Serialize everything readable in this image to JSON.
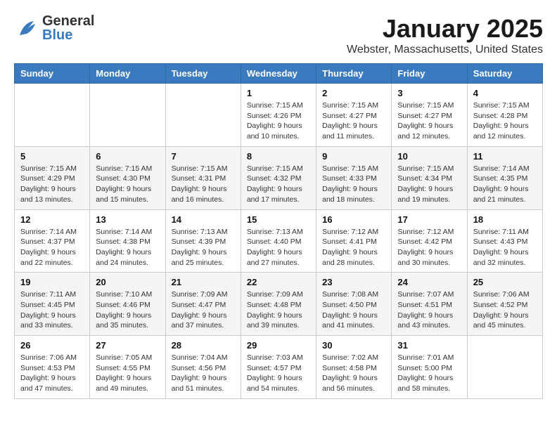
{
  "header": {
    "logo_general": "General",
    "logo_blue": "Blue",
    "title": "January 2025",
    "location": "Webster, Massachusetts, United States"
  },
  "weekdays": [
    "Sunday",
    "Monday",
    "Tuesday",
    "Wednesday",
    "Thursday",
    "Friday",
    "Saturday"
  ],
  "weeks": [
    [
      {
        "day": "",
        "info": ""
      },
      {
        "day": "",
        "info": ""
      },
      {
        "day": "",
        "info": ""
      },
      {
        "day": "1",
        "info": "Sunrise: 7:15 AM\nSunset: 4:26 PM\nDaylight: 9 hours\nand 10 minutes."
      },
      {
        "day": "2",
        "info": "Sunrise: 7:15 AM\nSunset: 4:27 PM\nDaylight: 9 hours\nand 11 minutes."
      },
      {
        "day": "3",
        "info": "Sunrise: 7:15 AM\nSunset: 4:27 PM\nDaylight: 9 hours\nand 12 minutes."
      },
      {
        "day": "4",
        "info": "Sunrise: 7:15 AM\nSunset: 4:28 PM\nDaylight: 9 hours\nand 12 minutes."
      }
    ],
    [
      {
        "day": "5",
        "info": "Sunrise: 7:15 AM\nSunset: 4:29 PM\nDaylight: 9 hours\nand 13 minutes."
      },
      {
        "day": "6",
        "info": "Sunrise: 7:15 AM\nSunset: 4:30 PM\nDaylight: 9 hours\nand 15 minutes."
      },
      {
        "day": "7",
        "info": "Sunrise: 7:15 AM\nSunset: 4:31 PM\nDaylight: 9 hours\nand 16 minutes."
      },
      {
        "day": "8",
        "info": "Sunrise: 7:15 AM\nSunset: 4:32 PM\nDaylight: 9 hours\nand 17 minutes."
      },
      {
        "day": "9",
        "info": "Sunrise: 7:15 AM\nSunset: 4:33 PM\nDaylight: 9 hours\nand 18 minutes."
      },
      {
        "day": "10",
        "info": "Sunrise: 7:15 AM\nSunset: 4:34 PM\nDaylight: 9 hours\nand 19 minutes."
      },
      {
        "day": "11",
        "info": "Sunrise: 7:14 AM\nSunset: 4:35 PM\nDaylight: 9 hours\nand 21 minutes."
      }
    ],
    [
      {
        "day": "12",
        "info": "Sunrise: 7:14 AM\nSunset: 4:37 PM\nDaylight: 9 hours\nand 22 minutes."
      },
      {
        "day": "13",
        "info": "Sunrise: 7:14 AM\nSunset: 4:38 PM\nDaylight: 9 hours\nand 24 minutes."
      },
      {
        "day": "14",
        "info": "Sunrise: 7:13 AM\nSunset: 4:39 PM\nDaylight: 9 hours\nand 25 minutes."
      },
      {
        "day": "15",
        "info": "Sunrise: 7:13 AM\nSunset: 4:40 PM\nDaylight: 9 hours\nand 27 minutes."
      },
      {
        "day": "16",
        "info": "Sunrise: 7:12 AM\nSunset: 4:41 PM\nDaylight: 9 hours\nand 28 minutes."
      },
      {
        "day": "17",
        "info": "Sunrise: 7:12 AM\nSunset: 4:42 PM\nDaylight: 9 hours\nand 30 minutes."
      },
      {
        "day": "18",
        "info": "Sunrise: 7:11 AM\nSunset: 4:43 PM\nDaylight: 9 hours\nand 32 minutes."
      }
    ],
    [
      {
        "day": "19",
        "info": "Sunrise: 7:11 AM\nSunset: 4:45 PM\nDaylight: 9 hours\nand 33 minutes."
      },
      {
        "day": "20",
        "info": "Sunrise: 7:10 AM\nSunset: 4:46 PM\nDaylight: 9 hours\nand 35 minutes."
      },
      {
        "day": "21",
        "info": "Sunrise: 7:09 AM\nSunset: 4:47 PM\nDaylight: 9 hours\nand 37 minutes."
      },
      {
        "day": "22",
        "info": "Sunrise: 7:09 AM\nSunset: 4:48 PM\nDaylight: 9 hours\nand 39 minutes."
      },
      {
        "day": "23",
        "info": "Sunrise: 7:08 AM\nSunset: 4:50 PM\nDaylight: 9 hours\nand 41 minutes."
      },
      {
        "day": "24",
        "info": "Sunrise: 7:07 AM\nSunset: 4:51 PM\nDaylight: 9 hours\nand 43 minutes."
      },
      {
        "day": "25",
        "info": "Sunrise: 7:06 AM\nSunset: 4:52 PM\nDaylight: 9 hours\nand 45 minutes."
      }
    ],
    [
      {
        "day": "26",
        "info": "Sunrise: 7:06 AM\nSunset: 4:53 PM\nDaylight: 9 hours\nand 47 minutes."
      },
      {
        "day": "27",
        "info": "Sunrise: 7:05 AM\nSunset: 4:55 PM\nDaylight: 9 hours\nand 49 minutes."
      },
      {
        "day": "28",
        "info": "Sunrise: 7:04 AM\nSunset: 4:56 PM\nDaylight: 9 hours\nand 51 minutes."
      },
      {
        "day": "29",
        "info": "Sunrise: 7:03 AM\nSunset: 4:57 PM\nDaylight: 9 hours\nand 54 minutes."
      },
      {
        "day": "30",
        "info": "Sunrise: 7:02 AM\nSunset: 4:58 PM\nDaylight: 9 hours\nand 56 minutes."
      },
      {
        "day": "31",
        "info": "Sunrise: 7:01 AM\nSunset: 5:00 PM\nDaylight: 9 hours\nand 58 minutes."
      },
      {
        "day": "",
        "info": ""
      }
    ]
  ]
}
